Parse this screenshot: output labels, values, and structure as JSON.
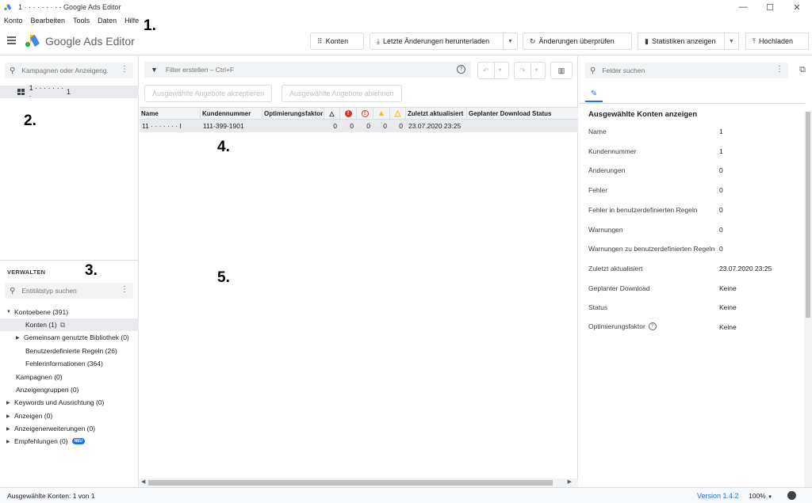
{
  "window": {
    "title": "1 · · · · · · · · - Google Ads Editor",
    "minimize": "—",
    "maximize": "☐",
    "close": "✕"
  },
  "menu": [
    "Konto",
    "Bearbeiten",
    "Tools",
    "Daten",
    "Hilfe"
  ],
  "annotations": [
    "1.",
    "2.",
    "3.",
    "4.",
    "5."
  ],
  "header": {
    "brand": "Google Ads Editor",
    "buttons": {
      "konten": "Konten",
      "download": "Letzte Änderungen herunterladen",
      "review": "Änderungen überprüfen",
      "stats": "Statistiken anzeigen",
      "upload": "Hochladen"
    }
  },
  "left": {
    "search_placeholder": "Kampagnen oder Anzeigeng...",
    "account_name": "1 · · · · · · · ·",
    "account_count": "1",
    "manage_title": "VERWALTEN",
    "entity_placeholder": "Entitätstyp suchen",
    "tree": [
      "Kontoebene (391)",
      "Konten (1)",
      "Gemeinsam genutzte Bibliothek (0)",
      "Benutzerdefinierte Regeln (26)",
      "Fehlerinformationen (364)",
      "Kampagnen (0)",
      "Anzeigengruppen (0)",
      "Keywords und Ausrichtung (0)",
      "Anzeigen (0)",
      "Anzeigenerweiterungen (0)",
      "Empfehlungen (0)"
    ],
    "badge_new": "NEU"
  },
  "mid": {
    "filter_placeholder": "Filter erstellen – Ctrl+F",
    "skip_label": "Ausgewählte Angebote akzeptieren",
    "reject_label": "Ausgewählte Angebote ablehnen",
    "columns": [
      "Name",
      "Kundennummer",
      "Optimierungsfaktor",
      "",
      "",
      "",
      "",
      "",
      "Zuletzt aktualisiert",
      "Geplanter Download Status"
    ],
    "row": [
      "11 · · · · · · · I",
      "111-399-1901",
      "",
      "0",
      "0",
      "0",
      "0",
      "0",
      "23.07.2020 23:25",
      ""
    ]
  },
  "right": {
    "search_placeholder": "Felder suchen",
    "title": "Ausgewählte Konten anzeigen",
    "props": [
      {
        "label": "Name",
        "value": "1"
      },
      {
        "label": "Kundennummer",
        "value": "1"
      },
      {
        "label": "Änderungen",
        "value": "0"
      },
      {
        "label": "Fehler",
        "value": "0"
      },
      {
        "label": "Fehler in benutzerdefinierten Regeln",
        "value": "0"
      },
      {
        "label": "Warnungen",
        "value": "0"
      },
      {
        "label": "Warnungen zu benutzerdefinierten Regeln",
        "value": "0"
      },
      {
        "label": "Zuletzt aktualisiert",
        "value": "23.07.2020 23:25"
      },
      {
        "label": "Geplanter Download",
        "value": "Keine"
      },
      {
        "label": "Status",
        "value": "Keine"
      },
      {
        "label": "Optimierungsfaktor",
        "value": "Keine"
      }
    ]
  },
  "status": {
    "selected": "Ausgewählte Konten: 1 von 1",
    "version": "Version 1.4.2",
    "zoom": "100%"
  },
  "colors": {
    "accent": "#1a73e8",
    "error": "#d93025",
    "warning": "#fbbc04"
  }
}
